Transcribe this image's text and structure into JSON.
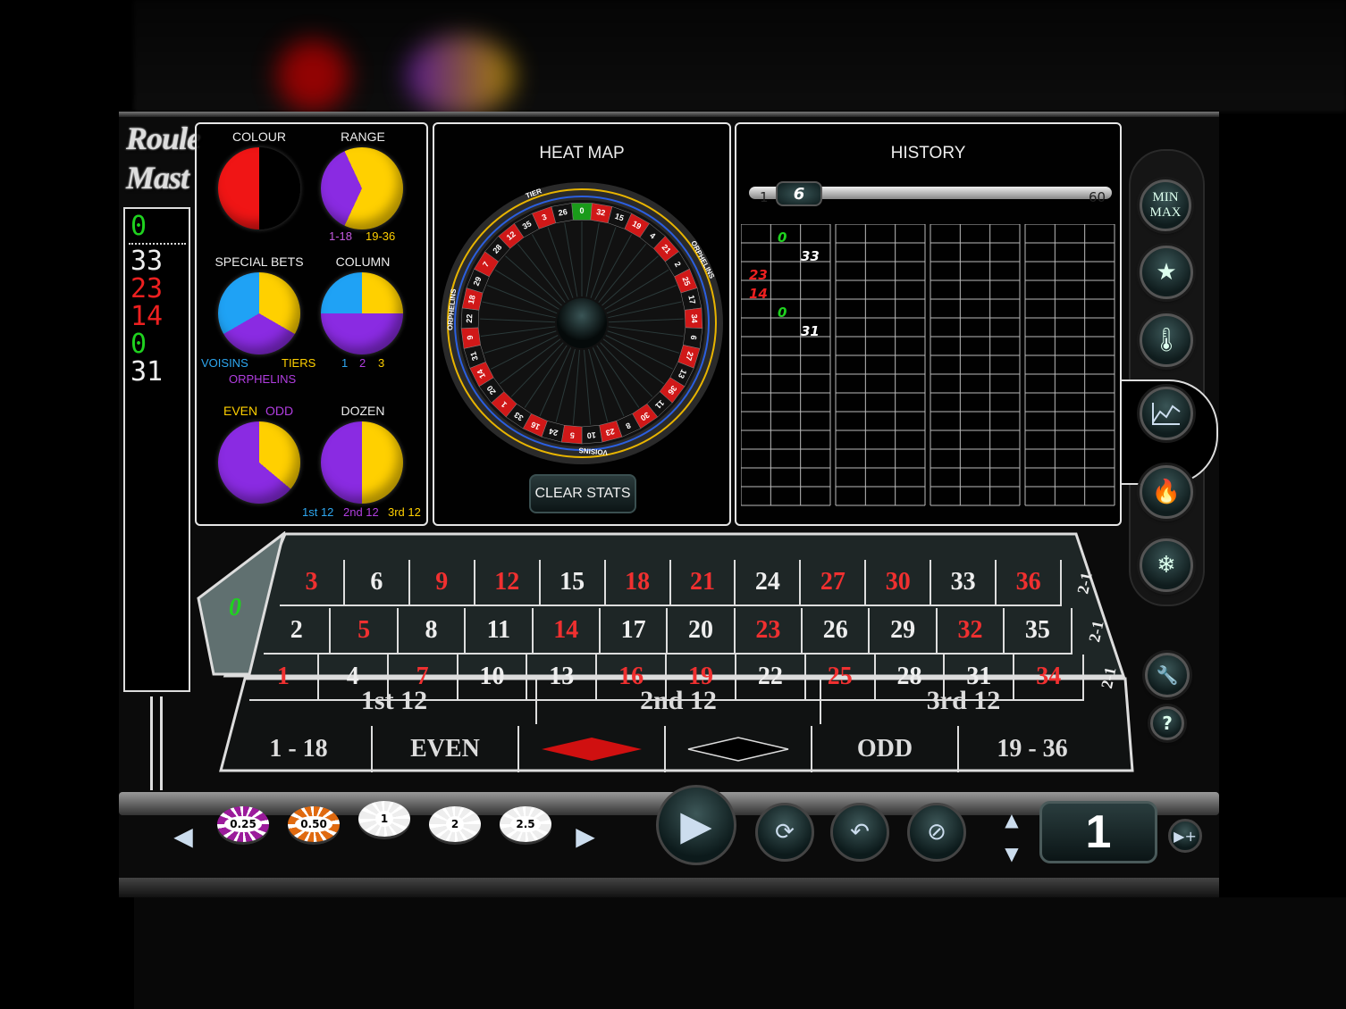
{
  "logo": {
    "line1": "Roule",
    "line2": "Mast"
  },
  "history_strip": {
    "values": [
      {
        "n": "0",
        "color": "#1fd21f"
      },
      {
        "n": "33",
        "color": "#eeeeee"
      },
      {
        "n": "23",
        "color": "#ee2020"
      },
      {
        "n": "14",
        "color": "#ee2020"
      },
      {
        "n": "0",
        "color": "#1fd21f"
      },
      {
        "n": "31",
        "color": "#eeeeee"
      }
    ]
  },
  "stats": {
    "colour": {
      "label": "COLOUR",
      "red_share": 0.5
    },
    "range": {
      "label": "RANGE",
      "low_label": "1-18",
      "high_label": "19-36",
      "low_share": 0.25
    },
    "special": {
      "label": "SPECIAL BETS",
      "voisins": "VOISINS",
      "tiers": "TIERS",
      "orphelins": "ORPHELINS"
    },
    "column": {
      "label": "COLUMN",
      "c1": "1",
      "c2": "2",
      "c3": "3"
    },
    "evenodd": {
      "label_even": "EVEN",
      "label_odd": "ODD",
      "odd_share": 0.85
    },
    "dozen": {
      "label": "DOZEN",
      "d1": "1st 12",
      "d2": "2nd 12",
      "d3": "3rd 12",
      "first_share": 0.5
    }
  },
  "heatmap": {
    "title": "HEAT MAP",
    "clear_label": "CLEAR STATS",
    "tiers_label": "TIER",
    "orph_label": "ORPHELINS",
    "voisins_label": "VOISINS",
    "wheel": [
      "0",
      "32",
      "15",
      "19",
      "4",
      "21",
      "2",
      "25",
      "17",
      "34",
      "6",
      "27",
      "13",
      "36",
      "11",
      "30",
      "8",
      "23",
      "10",
      "5",
      "24",
      "16",
      "33",
      "1",
      "20",
      "14",
      "31",
      "9",
      "22",
      "18",
      "29",
      "7",
      "28",
      "12",
      "35",
      "3",
      "26"
    ]
  },
  "history": {
    "title": "HISTORY",
    "slider_min": "1",
    "slider_value": "6",
    "slider_max": "60",
    "entries": [
      {
        "n": "0",
        "col": "green"
      },
      {
        "n": "33",
        "col": "black"
      },
      {
        "n": "23",
        "col": "red"
      },
      {
        "n": "14",
        "col": "red"
      },
      {
        "n": "0",
        "col": "green"
      },
      {
        "n": "31",
        "col": "black"
      }
    ]
  },
  "side": {
    "minmax_1": "MIN",
    "minmax_2": "MAX",
    "help": "?"
  },
  "table": {
    "zero": "0",
    "rows": [
      [
        {
          "n": "3",
          "c": "red"
        },
        {
          "n": "6",
          "c": "black"
        },
        {
          "n": "9",
          "c": "red"
        },
        {
          "n": "12",
          "c": "red"
        },
        {
          "n": "15",
          "c": "black"
        },
        {
          "n": "18",
          "c": "red"
        },
        {
          "n": "21",
          "c": "red"
        },
        {
          "n": "24",
          "c": "black"
        },
        {
          "n": "27",
          "c": "red"
        },
        {
          "n": "30",
          "c": "red"
        },
        {
          "n": "33",
          "c": "black"
        },
        {
          "n": "36",
          "c": "red"
        }
      ],
      [
        {
          "n": "2",
          "c": "black"
        },
        {
          "n": "5",
          "c": "red"
        },
        {
          "n": "8",
          "c": "black"
        },
        {
          "n": "11",
          "c": "black"
        },
        {
          "n": "14",
          "c": "red"
        },
        {
          "n": "17",
          "c": "black"
        },
        {
          "n": "20",
          "c": "black"
        },
        {
          "n": "23",
          "c": "red"
        },
        {
          "n": "26",
          "c": "black"
        },
        {
          "n": "29",
          "c": "black"
        },
        {
          "n": "32",
          "c": "red"
        },
        {
          "n": "35",
          "c": "black"
        }
      ],
      [
        {
          "n": "1",
          "c": "red"
        },
        {
          "n": "4",
          "c": "black"
        },
        {
          "n": "7",
          "c": "red"
        },
        {
          "n": "10",
          "c": "black"
        },
        {
          "n": "13",
          "c": "black"
        },
        {
          "n": "16",
          "c": "red"
        },
        {
          "n": "19",
          "c": "red"
        },
        {
          "n": "22",
          "c": "black"
        },
        {
          "n": "25",
          "c": "red"
        },
        {
          "n": "28",
          "c": "black"
        },
        {
          "n": "31",
          "c": "black"
        },
        {
          "n": "34",
          "c": "red"
        }
      ]
    ],
    "column_bet": "2-1",
    "dozens": [
      "1st 12",
      "2nd 12",
      "3rd 12"
    ],
    "outside": [
      "1 - 18",
      "EVEN",
      "",
      "",
      "ODD",
      "19 - 36"
    ]
  },
  "chips": [
    {
      "v": "0.25",
      "color": "#9b1b9b"
    },
    {
      "v": "0.50",
      "color": "#e06a10"
    },
    {
      "v": "1",
      "color": "#eeeeee"
    },
    {
      "v": "2",
      "color": "#eeeeee"
    },
    {
      "v": "2.5",
      "color": "#eeeeee"
    }
  ],
  "bet_value": "1"
}
